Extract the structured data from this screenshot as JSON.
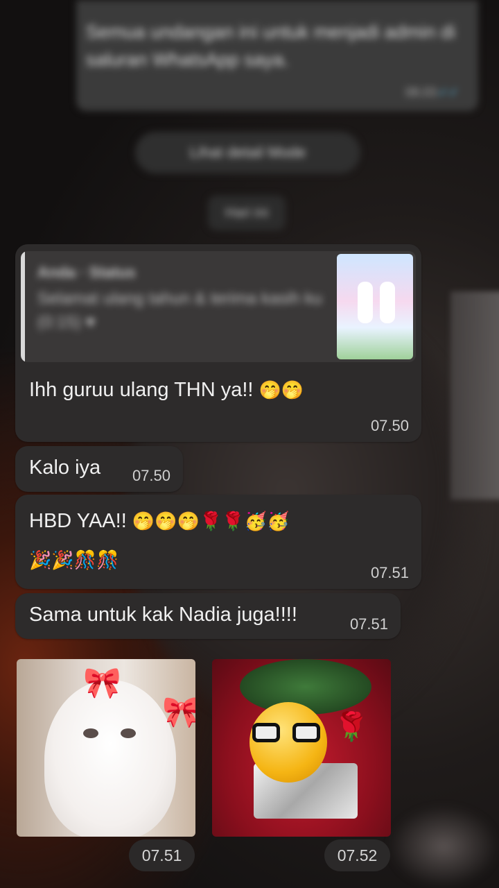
{
  "top_message": {
    "text": "Semua undangan ini untuk menjadi admin di saluran WhatsApp saya. ",
    "time": "08.03",
    "ticks": "✓✓"
  },
  "system_pill": {
    "text": "Lihat detail Mode"
  },
  "date_chip": {
    "text": "Hari ini"
  },
  "messages": [
    {
      "quote": {
        "author": "Anda · Status",
        "text": "Selamat ulang tahun & terima kasih ku (0:15)",
        "heart": "♥"
      },
      "text": "Ihh guruu ulang THN ya!!",
      "emojis": "🤭🤭",
      "time": "07.50"
    },
    {
      "text": "Kalo iya",
      "time": "07.50"
    },
    {
      "text": "HBD YAA!!",
      "emojis_line1": "🤭🤭🤭🌹🌹🥳🥳",
      "emojis_line2": "🎉🎉🎊🎊",
      "time": "07.51"
    },
    {
      "text": "Sama untuk kak Nadia juga!!!!",
      "time": "07.51"
    }
  ],
  "stickers": [
    {
      "name": "white kitten with pink bows",
      "time": "07.51"
    },
    {
      "name": "emoji with glasses on gift and roses",
      "time": "07.52"
    }
  ],
  "colors": {
    "bubble": "#2d2b2b",
    "time_text": "#d0d0d0",
    "read_ticks": "#53bdeb"
  }
}
